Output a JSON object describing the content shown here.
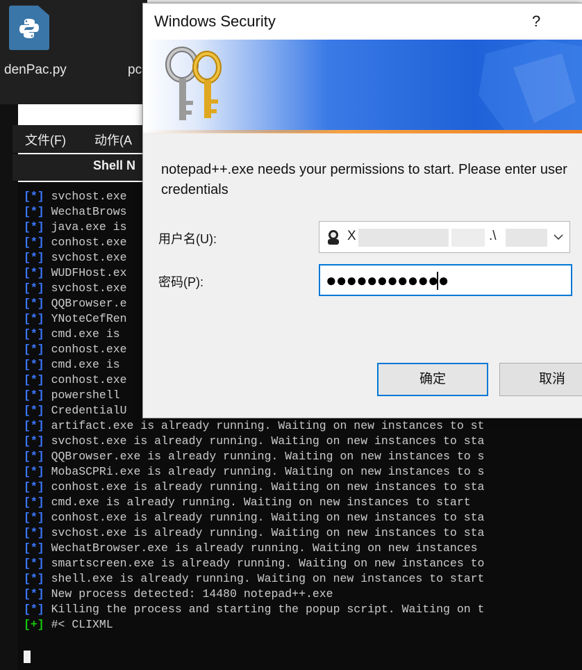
{
  "explorer": {
    "file_1": "denPac.py",
    "file_2": "pc"
  },
  "app": {
    "menu": [
      "文件(F)",
      "动作(A"
    ],
    "tab": "Shell N"
  },
  "terminal": {
    "lines": [
      {
        "tag": "[*]",
        "text": " svchost.exe"
      },
      {
        "tag": "[*]",
        "text": " WechatBrows"
      },
      {
        "tag": "[*]",
        "text": " java.exe is"
      },
      {
        "tag": "[*]",
        "text": " conhost.exe"
      },
      {
        "tag": "[*]",
        "text": " svchost.exe"
      },
      {
        "tag": "[*]",
        "text": " WUDFHost.ex"
      },
      {
        "tag": "[*]",
        "text": " svchost.exe"
      },
      {
        "tag": "[*]",
        "text": " QQBrowser.e"
      },
      {
        "tag": "[*]",
        "text": " YNoteCefRen"
      },
      {
        "tag": "[*]",
        "text": " cmd.exe is"
      },
      {
        "tag": "[*]",
        "text": " conhost.exe"
      },
      {
        "tag": "[*]",
        "text": " cmd.exe is"
      },
      {
        "tag": "[*]",
        "text": " conhost.exe"
      },
      {
        "tag": "[*]",
        "text": " powershell"
      },
      {
        "tag": "[*]",
        "text": " CredentialU"
      },
      {
        "tag": "[*]",
        "text": " artifact.exe is already running. Waiting on new instances to st"
      },
      {
        "tag": "[*]",
        "text": " svchost.exe is already running. Waiting on new instances to sta"
      },
      {
        "tag": "[*]",
        "text": " QQBrowser.exe is already running. Waiting on new instances to s"
      },
      {
        "tag": "[*]",
        "text": " MobaSCPRi.exe is already running. Waiting on new instances to s"
      },
      {
        "tag": "[*]",
        "text": " conhost.exe is already running. Waiting on new instances to sta"
      },
      {
        "tag": "[*]",
        "text": " cmd.exe is already running. Waiting on new instances to start"
      },
      {
        "tag": "[*]",
        "text": " conhost.exe is already running. Waiting on new instances to sta"
      },
      {
        "tag": "[*]",
        "text": " svchost.exe is already running. Waiting on new instances to sta"
      },
      {
        "tag": "[*]",
        "text": " WechatBrowser.exe is already running. Waiting on new instances"
      },
      {
        "tag": "[*]",
        "text": " smartscreen.exe is already running. Waiting on new instances to"
      },
      {
        "tag": "[*]",
        "text": " shell.exe is already running. Waiting on new instances to start"
      },
      {
        "tag": "[*]",
        "text": " New process detected: 14480 notepad++.exe"
      },
      {
        "tag": "[*]",
        "text": " Killing the process and starting the popup script. Waiting on t"
      },
      {
        "tag": "[+]",
        "text": " #< CLIXML"
      }
    ]
  },
  "dialog": {
    "title": "Windows Security",
    "help": "?",
    "message": "notepad++.exe needs your permissions to start. Please enter user credentials",
    "username_label": "用户名(U):",
    "password_label": "密码(P):",
    "username_prefix": "X",
    "username_sep": ".\\",
    "password_dots": "●●●●●●●●●●●●",
    "ok_label": "确定",
    "cancel_label": "取消"
  }
}
